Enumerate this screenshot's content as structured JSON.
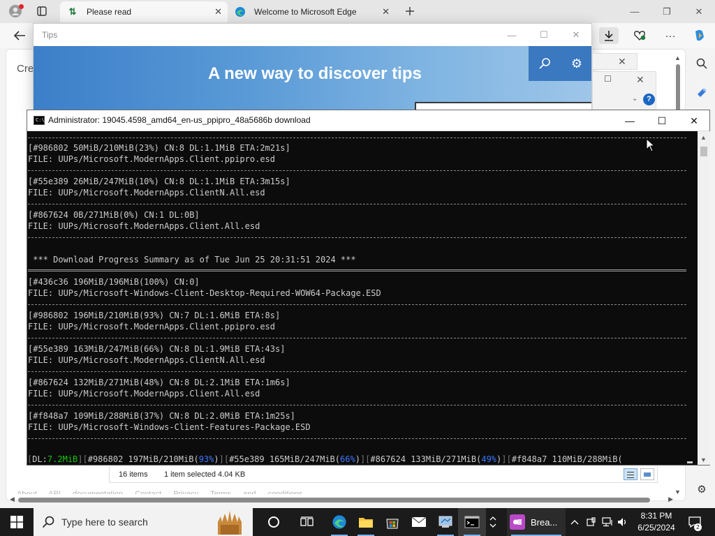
{
  "edge": {
    "tabs": [
      {
        "label": "Please read"
      },
      {
        "label": "Welcome to Microsoft Edge"
      }
    ],
    "page_partial_text": "Cre",
    "footer_links": [
      "About",
      "API documentation",
      "Contact",
      "Privacy",
      "Terms and conditions"
    ]
  },
  "tips": {
    "title": "Tips",
    "headline": "A new way to discover tips"
  },
  "console": {
    "title": "Administrator:  19045.4598_amd64_en-us_ppipro_48a5686b download",
    "lines": [
      "[#986802 50MiB/210MiB(23%) CN:8 DL:1.1MiB ETA:2m21s]",
      "FILE: UUPs/Microsoft.ModernApps.Client.ppipro.esd",
      "[#55e389 26MiB/247MiB(10%) CN:8 DL:1.1MiB ETA:3m15s]",
      "FILE: UUPs/Microsoft.ModernApps.ClientN.All.esd",
      "[#867624 0B/271MiB(0%) CN:1 DL:0B]",
      "FILE: UUPs/Microsoft.ModernApps.Client.All.esd",
      " *** Download Progress Summary as of Tue Jun 25 20:31:51 2024 ***",
      "[#436c36 196MiB/196MiB(100%) CN:0]",
      "FILE: UUPs/Microsoft-Windows-Client-Desktop-Required-WOW64-Package.ESD",
      "[#986802 196MiB/210MiB(93%) CN:7 DL:1.6MiB ETA:8s]",
      "FILE: UUPs/Microsoft.ModernApps.Client.ppipro.esd",
      "[#55e389 163MiB/247MiB(66%) CN:8 DL:1.9MiB ETA:43s]",
      "FILE: UUPs/Microsoft.ModernApps.ClientN.All.esd",
      "[#867624 132MiB/271MiB(48%) CN:8 DL:2.1MiB ETA:1m6s]",
      "FILE: UUPs/Microsoft.ModernApps.Client.All.esd",
      "[#f848a7 109MiB/288MiB(37%) CN:8 DL:2.0MiB ETA:1m25s]",
      "FILE: UUPs/Microsoft-Windows-Client-Features-Package.ESD"
    ],
    "status": {
      "dl_label": "DL:",
      "dl_value": "7.2MiB",
      "items": [
        {
          "head": "#986802 197MiB/210MiB(",
          "pct": "93%",
          "tail": ")"
        },
        {
          "head": "#55e389 165MiB/247MiB(",
          "pct": "66%",
          "tail": ")"
        },
        {
          "head": "#867624 133MiB/271MiB(",
          "pct": "49%",
          "tail": ")"
        },
        {
          "head": "#f848a7 110MiB/288MiB(",
          "pct": "",
          "tail": ""
        }
      ]
    }
  },
  "explorer_status": {
    "items_count": "16 items",
    "selection": "1 item selected  4.04 KB"
  },
  "taskbar": {
    "search_placeholder": "Type here to search",
    "app_label": "Brea...",
    "time": "8:31 PM",
    "date": "6/25/2024",
    "notification_count": "2"
  },
  "colors": {
    "console_bg": "#0c0c0c",
    "console_text": "#cccccc",
    "console_green": "#16c60c",
    "console_blue": "#3b78ff",
    "taskbar_bg": "#1b1b1b",
    "tips_blue": "#3a78c0"
  }
}
